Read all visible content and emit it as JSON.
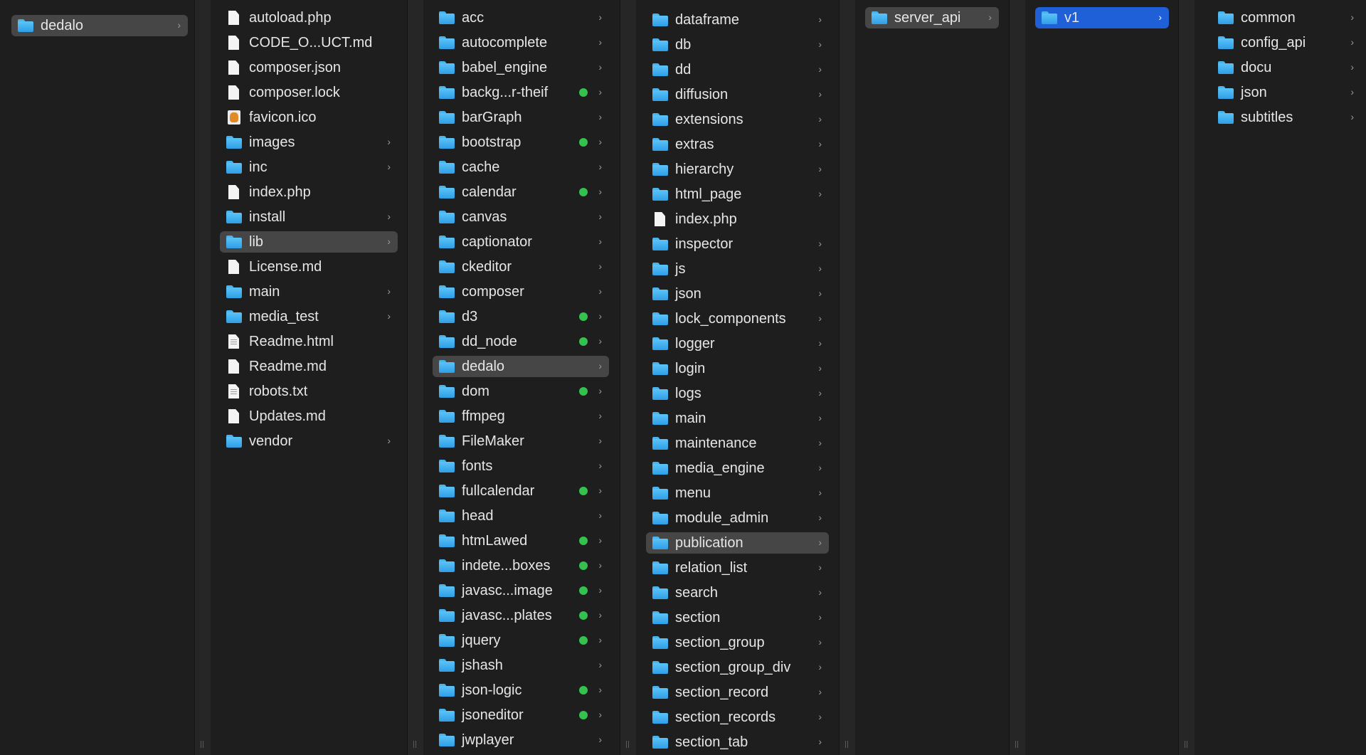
{
  "columns": [
    {
      "id": "col1",
      "items": [
        {
          "name": "dedalo",
          "kind": "folder",
          "chevron": true,
          "selected": "gray"
        }
      ]
    },
    {
      "id": "col2",
      "items": [
        {
          "name": "autoload.php",
          "kind": "file"
        },
        {
          "name": "CODE_O...UCT.md",
          "kind": "file"
        },
        {
          "name": "composer.json",
          "kind": "file"
        },
        {
          "name": "composer.lock",
          "kind": "file"
        },
        {
          "name": "favicon.ico",
          "kind": "ico"
        },
        {
          "name": "images",
          "kind": "folder",
          "chevron": true
        },
        {
          "name": "inc",
          "kind": "folder",
          "chevron": true
        },
        {
          "name": "index.php",
          "kind": "file"
        },
        {
          "name": "install",
          "kind": "folder",
          "chevron": true
        },
        {
          "name": "lib",
          "kind": "folder",
          "chevron": true,
          "selected": "gray"
        },
        {
          "name": "License.md",
          "kind": "file"
        },
        {
          "name": "main",
          "kind": "folder",
          "chevron": true
        },
        {
          "name": "media_test",
          "kind": "folder",
          "chevron": true
        },
        {
          "name": "Readme.html",
          "kind": "file-lined"
        },
        {
          "name": "Readme.md",
          "kind": "file"
        },
        {
          "name": "robots.txt",
          "kind": "file-lined"
        },
        {
          "name": "Updates.md",
          "kind": "file"
        },
        {
          "name": "vendor",
          "kind": "folder",
          "chevron": true
        }
      ]
    },
    {
      "id": "col3",
      "items": [
        {
          "name": "acc",
          "kind": "folder",
          "chevron": true
        },
        {
          "name": "autocomplete",
          "kind": "folder",
          "chevron": true
        },
        {
          "name": "babel_engine",
          "kind": "folder",
          "chevron": true
        },
        {
          "name": "backg...r-theif",
          "kind": "folder",
          "chevron": true,
          "tag": "green"
        },
        {
          "name": "barGraph",
          "kind": "folder",
          "chevron": true
        },
        {
          "name": "bootstrap",
          "kind": "folder",
          "chevron": true,
          "tag": "green"
        },
        {
          "name": "cache",
          "kind": "folder",
          "chevron": true
        },
        {
          "name": "calendar",
          "kind": "folder",
          "chevron": true,
          "tag": "green"
        },
        {
          "name": "canvas",
          "kind": "folder",
          "chevron": true
        },
        {
          "name": "captionator",
          "kind": "folder",
          "chevron": true
        },
        {
          "name": "ckeditor",
          "kind": "folder",
          "chevron": true
        },
        {
          "name": "composer",
          "kind": "folder",
          "chevron": true
        },
        {
          "name": "d3",
          "kind": "folder",
          "chevron": true,
          "tag": "green"
        },
        {
          "name": "dd_node",
          "kind": "folder",
          "chevron": true,
          "tag": "green"
        },
        {
          "name": "dedalo",
          "kind": "folder",
          "chevron": true,
          "selected": "gray"
        },
        {
          "name": "dom",
          "kind": "folder",
          "chevron": true,
          "tag": "green"
        },
        {
          "name": "ffmpeg",
          "kind": "folder",
          "chevron": true
        },
        {
          "name": "FileMaker",
          "kind": "folder",
          "chevron": true
        },
        {
          "name": "fonts",
          "kind": "folder",
          "chevron": true
        },
        {
          "name": "fullcalendar",
          "kind": "folder",
          "chevron": true,
          "tag": "green"
        },
        {
          "name": "head",
          "kind": "folder",
          "chevron": true
        },
        {
          "name": "htmLawed",
          "kind": "folder",
          "chevron": true,
          "tag": "green"
        },
        {
          "name": "indete...boxes",
          "kind": "folder",
          "chevron": true,
          "tag": "green"
        },
        {
          "name": "javasc...image",
          "kind": "folder",
          "chevron": true,
          "tag": "green"
        },
        {
          "name": "javasc...plates",
          "kind": "folder",
          "chevron": true,
          "tag": "green"
        },
        {
          "name": "jquery",
          "kind": "folder",
          "chevron": true,
          "tag": "green"
        },
        {
          "name": "jshash",
          "kind": "folder",
          "chevron": true
        },
        {
          "name": "json-logic",
          "kind": "folder",
          "chevron": true,
          "tag": "green"
        },
        {
          "name": "jsoneditor",
          "kind": "folder",
          "chevron": true,
          "tag": "green"
        },
        {
          "name": "jwplayer",
          "kind": "folder",
          "chevron": true
        }
      ]
    },
    {
      "id": "col4",
      "items": [
        {
          "name": "dataframe",
          "kind": "folder",
          "chevron": true
        },
        {
          "name": "db",
          "kind": "folder",
          "chevron": true
        },
        {
          "name": "dd",
          "kind": "folder",
          "chevron": true
        },
        {
          "name": "diffusion",
          "kind": "folder",
          "chevron": true
        },
        {
          "name": "extensions",
          "kind": "folder",
          "chevron": true
        },
        {
          "name": "extras",
          "kind": "folder",
          "chevron": true
        },
        {
          "name": "hierarchy",
          "kind": "folder",
          "chevron": true
        },
        {
          "name": "html_page",
          "kind": "folder",
          "chevron": true
        },
        {
          "name": "index.php",
          "kind": "file"
        },
        {
          "name": "inspector",
          "kind": "folder",
          "chevron": true
        },
        {
          "name": "js",
          "kind": "folder",
          "chevron": true
        },
        {
          "name": "json",
          "kind": "folder",
          "chevron": true
        },
        {
          "name": "lock_components",
          "kind": "folder",
          "chevron": true
        },
        {
          "name": "logger",
          "kind": "folder",
          "chevron": true
        },
        {
          "name": "login",
          "kind": "folder",
          "chevron": true
        },
        {
          "name": "logs",
          "kind": "folder",
          "chevron": true
        },
        {
          "name": "main",
          "kind": "folder",
          "chevron": true
        },
        {
          "name": "maintenance",
          "kind": "folder",
          "chevron": true
        },
        {
          "name": "media_engine",
          "kind": "folder",
          "chevron": true
        },
        {
          "name": "menu",
          "kind": "folder",
          "chevron": true
        },
        {
          "name": "module_admin",
          "kind": "folder",
          "chevron": true
        },
        {
          "name": "publication",
          "kind": "folder",
          "chevron": true,
          "selected": "gray"
        },
        {
          "name": "relation_list",
          "kind": "folder",
          "chevron": true
        },
        {
          "name": "search",
          "kind": "folder",
          "chevron": true
        },
        {
          "name": "section",
          "kind": "folder",
          "chevron": true
        },
        {
          "name": "section_group",
          "kind": "folder",
          "chevron": true
        },
        {
          "name": "section_group_div",
          "kind": "folder",
          "chevron": true
        },
        {
          "name": "section_record",
          "kind": "folder",
          "chevron": true
        },
        {
          "name": "section_records",
          "kind": "folder",
          "chevron": true
        },
        {
          "name": "section_tab",
          "kind": "folder",
          "chevron": true
        }
      ]
    },
    {
      "id": "col5",
      "items": [
        {
          "name": "server_api",
          "kind": "folder",
          "chevron": true,
          "selected": "gray"
        }
      ]
    },
    {
      "id": "col6",
      "items": [
        {
          "name": "v1",
          "kind": "folder",
          "chevron": true,
          "selected": "blue"
        }
      ]
    },
    {
      "id": "col7",
      "items": [
        {
          "name": "common",
          "kind": "folder",
          "chevron": true
        },
        {
          "name": "config_api",
          "kind": "folder",
          "chevron": true
        },
        {
          "name": "docu",
          "kind": "folder",
          "chevron": true
        },
        {
          "name": "json",
          "kind": "folder",
          "chevron": true
        },
        {
          "name": "subtitles",
          "kind": "folder",
          "chevron": true
        }
      ]
    }
  ],
  "colors": {
    "background": "#1e1e1e",
    "selection_gray": "#464646",
    "selection_blue": "#1f60d8",
    "folder": "#3fa9ef",
    "tag_green": "#32c24d"
  },
  "chevron_glyph": "›"
}
